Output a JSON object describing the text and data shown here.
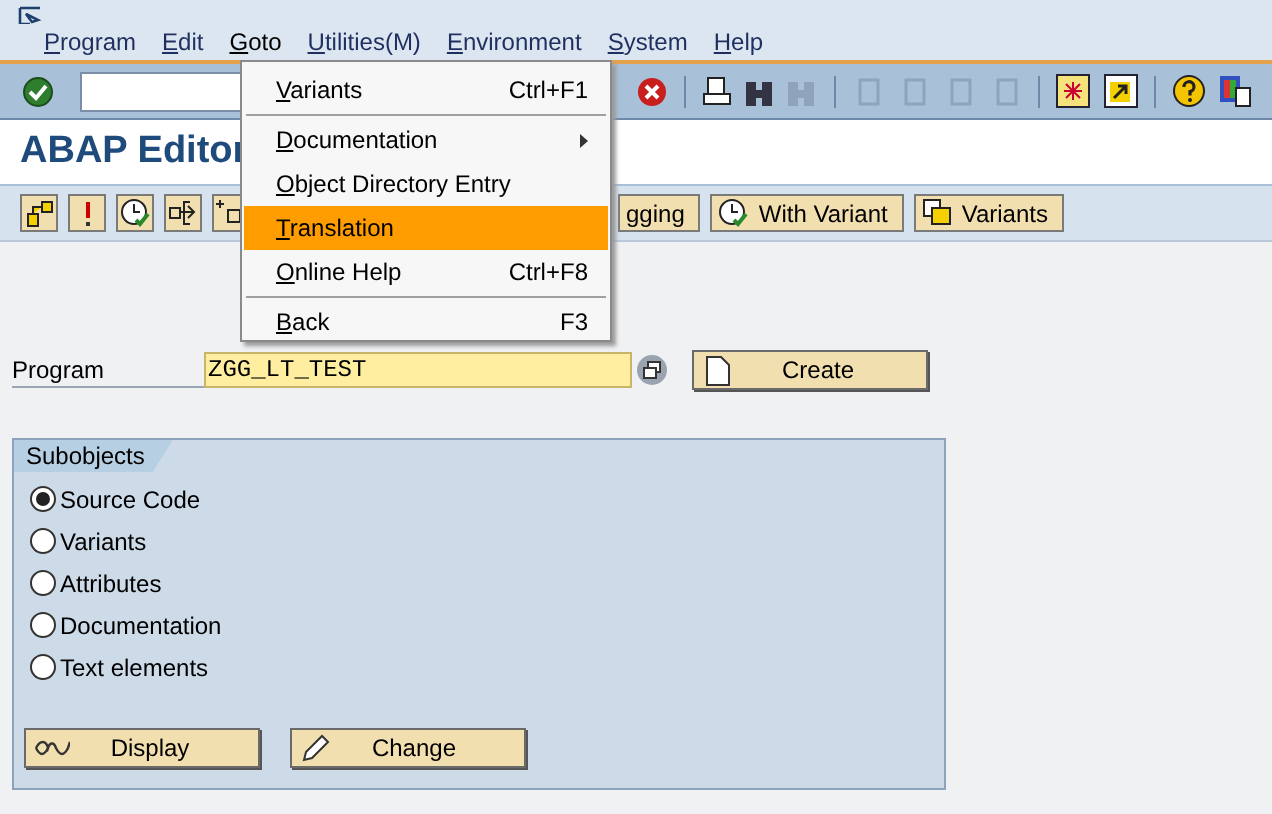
{
  "menu_bar": [
    {
      "label": "Program",
      "selected": false
    },
    {
      "label": "Edit",
      "selected": false
    },
    {
      "label": "Goto",
      "selected": true
    },
    {
      "label": "Utilities(M)",
      "selected": false
    },
    {
      "label": "Environment",
      "selected": false
    },
    {
      "label": "System",
      "selected": false
    },
    {
      "label": "Help",
      "selected": false
    }
  ],
  "title": "ABAP Editor",
  "app_toolbar_buttons": [
    {
      "label": "gging"
    },
    {
      "label": "With Variant"
    },
    {
      "label": "Variants"
    }
  ],
  "program_field": {
    "label": "Program",
    "value": "ZGG_LT_TEST"
  },
  "create_button": "Create",
  "subobjects": {
    "title": "Subobjects",
    "options": [
      {
        "label": "Source Code",
        "selected": true
      },
      {
        "label": "Variants",
        "selected": false
      },
      {
        "label": "Attributes",
        "selected": false
      },
      {
        "label": "Documentation",
        "selected": false
      },
      {
        "label": "Text elements",
        "selected": false
      }
    ]
  },
  "buttons": [
    {
      "label": "Display",
      "kind": "display"
    },
    {
      "label": "Change",
      "kind": "change"
    }
  ],
  "dropdown": [
    {
      "kind": "item",
      "label": "Variants",
      "shortcut": "Ctrl+F1",
      "selected": false
    },
    {
      "kind": "separator"
    },
    {
      "kind": "submenu",
      "label": "Documentation",
      "selected": false
    },
    {
      "kind": "item",
      "label": "Object Directory Entry",
      "selected": false
    },
    {
      "kind": "item",
      "label": "Translation",
      "selected": true
    },
    {
      "kind": "item",
      "label": "Online Help",
      "shortcut": "Ctrl+F8",
      "selected": false
    },
    {
      "kind": "separator"
    },
    {
      "kind": "item",
      "label": "Back",
      "shortcut": "F3",
      "selected": false
    }
  ]
}
